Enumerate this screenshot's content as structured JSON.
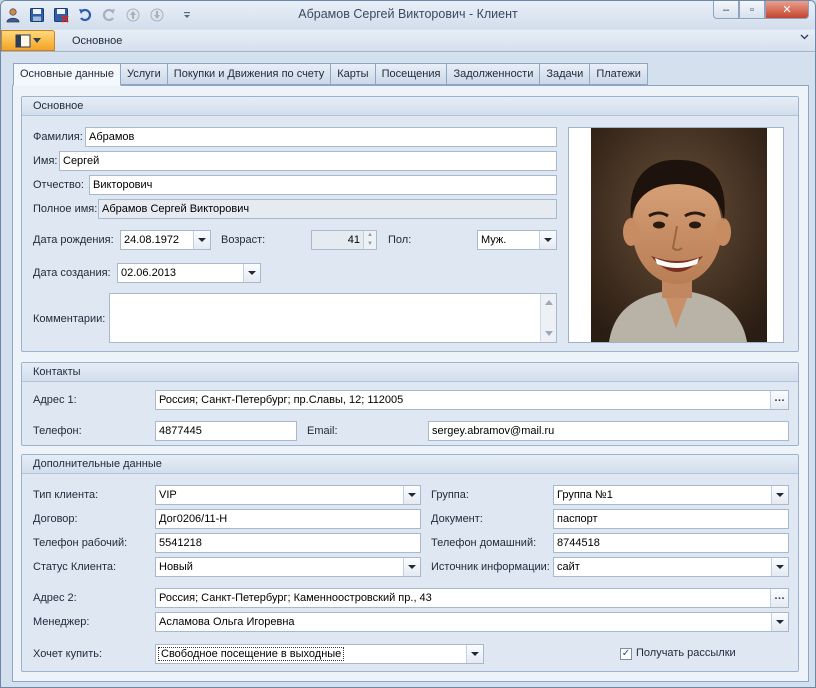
{
  "window": {
    "title": "Абрамов Сергей Викторович - Клиент",
    "controls": {
      "minimize": "–",
      "maximize": "▫",
      "close": "✕"
    }
  },
  "quick_access": [
    "user-icon",
    "save-icon",
    "save-close-icon",
    "undo-icon",
    "redo-icon",
    "up-icon",
    "down-icon",
    "customize-icon"
  ],
  "ribbon": {
    "tab_label": "Основное"
  },
  "tabs": [
    {
      "label": "Основные данные",
      "active": true
    },
    {
      "label": "Услуги"
    },
    {
      "label": "Покупки и Движения по счету"
    },
    {
      "label": "Карты"
    },
    {
      "label": "Посещения"
    },
    {
      "label": "Задолженности"
    },
    {
      "label": "Задачи"
    },
    {
      "label": "Платежи"
    }
  ],
  "basic": {
    "header": "Основное",
    "surname_label": "Фамилия:",
    "surname": "Абрамов",
    "name_label": "Имя:",
    "name": "Сергей",
    "patronymic_label": "Отчество:",
    "patronymic": "Викторович",
    "fullname_label": "Полное имя:",
    "fullname": "Абрамов Сергей Викторович",
    "birth_label": "Дата рождения:",
    "birth": "24.08.1972",
    "age_label": "Возраст:",
    "age": "41",
    "sex_label": "Пол:",
    "sex": "Муж.",
    "created_label": "Дата создания:",
    "created": "02.06.2013",
    "comments_label": "Комментарии:",
    "comments": ""
  },
  "contacts": {
    "header": "Контакты",
    "address1_label": "Адрес 1:",
    "address1": "Россия; Санкт-Петербург; пр.Славы, 12; 112005",
    "phone_label": "Телефон:",
    "phone": "4877445",
    "email_label": "Email:",
    "email": "sergey.abramov@mail.ru"
  },
  "extra": {
    "header": "Дополнительные данные",
    "client_type_label": "Тип клиента:",
    "client_type": "VIP",
    "group_label": "Группа:",
    "group": "Группа №1",
    "contract_label": "Договор:",
    "contract": "Дог0206/11-Н",
    "document_label": "Документ:",
    "document": "паспорт",
    "work_phone_label": "Телефон рабочий:",
    "work_phone": "5541218",
    "home_phone_label": "Телефон домашний:",
    "home_phone": "8744518",
    "status_label": "Статус Клиента:",
    "status": "Новый",
    "source_label": "Источник информации:",
    "source": "сайт",
    "address2_label": "Адрес 2:",
    "address2": "Россия; Санкт-Петербург; Каменноостровский пр., 43",
    "manager_label": "Менеджер:",
    "manager": "Асламова Ольга Игоревна",
    "wants_label": "Хочет купить:",
    "wants": "Свободное посещение в выходные",
    "newsletter_label": "Получать рассылки",
    "newsletter_checked": "✓"
  },
  "colors": {
    "accent": "#f4a324",
    "frame": "#8ea6c4",
    "background": "#d5e0ee"
  }
}
